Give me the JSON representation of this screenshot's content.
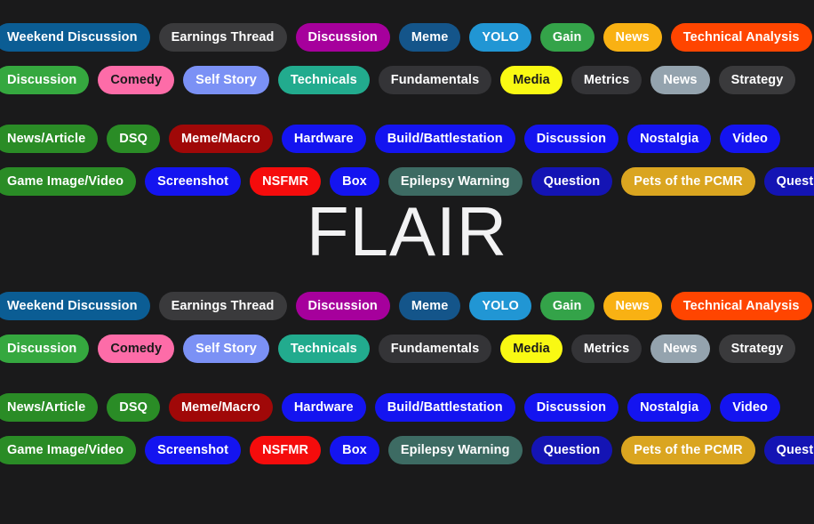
{
  "page": {
    "background_color": "#1a1a1b",
    "heading": "FLAIR",
    "heading_color": "#f2f2f3"
  },
  "flair_groups": [
    {
      "name": "group-top",
      "rows": [
        {
          "name": "row-wsb-1",
          "chips": [
            {
              "label": "Weekend Discussion",
              "bg": "#0b5d94",
              "fg": "#ffffff"
            },
            {
              "label": "Earnings Thread",
              "bg": "#3a3a3c",
              "fg": "#ffffff"
            },
            {
              "label": "Discussion",
              "bg": "#a6009c",
              "fg": "#ffffff"
            },
            {
              "label": "Meme",
              "bg": "#14558a",
              "fg": "#ffffff"
            },
            {
              "label": "YOLO",
              "bg": "#2196d4",
              "fg": "#ffffff"
            },
            {
              "label": "Gain",
              "bg": "#34a349",
              "fg": "#ffffff"
            },
            {
              "label": "News",
              "bg": "#f9b113",
              "fg": "#ffffff"
            },
            {
              "label": "Technical Analysis",
              "bg": "#ff4500",
              "fg": "#ffffff"
            }
          ]
        },
        {
          "name": "row-wsb-2",
          "chips": [
            {
              "label": "Discussion",
              "bg": "#35a83f",
              "fg": "#ffffff"
            },
            {
              "label": "Comedy",
              "bg": "#fd6ca8",
              "fg": "#1a1a1b"
            },
            {
              "label": "Self Story",
              "bg": "#7b91f5",
              "fg": "#ffffff"
            },
            {
              "label": "Technicals",
              "bg": "#22ab8e",
              "fg": "#ffffff"
            },
            {
              "label": "Fundamentals",
              "bg": "#343437",
              "fg": "#ffffff"
            },
            {
              "label": "Media",
              "bg": "#f9f913",
              "fg": "#1a1a1b"
            },
            {
              "label": "Metrics",
              "bg": "#343437",
              "fg": "#ffffff"
            },
            {
              "label": "News",
              "bg": "#94a3ae",
              "fg": "#ffffff"
            },
            {
              "label": "Strategy",
              "bg": "#3a3a3c",
              "fg": "#ffffff"
            }
          ]
        },
        {
          "name": "row-pcmr-1",
          "chips": [
            {
              "label": "News/Article",
              "bg": "#2a8c26",
              "fg": "#ffffff"
            },
            {
              "label": "DSQ",
              "bg": "#2a8c26",
              "fg": "#ffffff"
            },
            {
              "label": "Meme/Macro",
              "bg": "#a00808",
              "fg": "#ffffff"
            },
            {
              "label": "Hardware",
              "bg": "#1414f0",
              "fg": "#ffffff"
            },
            {
              "label": "Build/Battlestation",
              "bg": "#1414f0",
              "fg": "#ffffff"
            },
            {
              "label": "Discussion",
              "bg": "#1414f0",
              "fg": "#ffffff"
            },
            {
              "label": "Nostalgia",
              "bg": "#1414f0",
              "fg": "#ffffff"
            },
            {
              "label": "Video",
              "bg": "#1414f0",
              "fg": "#ffffff"
            }
          ]
        },
        {
          "name": "row-pcmr-2",
          "chips": [
            {
              "label": "Game Image/Video",
              "bg": "#2a8c26",
              "fg": "#ffffff"
            },
            {
              "label": "Screenshot",
              "bg": "#1414f0",
              "fg": "#ffffff"
            },
            {
              "label": "NSFMR",
              "bg": "#f50c0c",
              "fg": "#ffffff"
            },
            {
              "label": "Box",
              "bg": "#1414f0",
              "fg": "#ffffff"
            },
            {
              "label": "Epilepsy Warning",
              "bg": "#3d6b63",
              "fg": "#ffffff"
            },
            {
              "label": "Question",
              "bg": "#1414b4",
              "fg": "#ffffff"
            },
            {
              "label": "Pets of the PCMR",
              "bg": "#daa520",
              "fg": "#ffffff"
            },
            {
              "label": "Question",
              "bg": "#1414b4",
              "fg": "#ffffff"
            }
          ]
        }
      ]
    },
    {
      "name": "group-bottom",
      "rows": [
        {
          "name": "row-wsb-1",
          "chips": [
            {
              "label": "Weekend Discussion",
              "bg": "#0b5d94",
              "fg": "#ffffff"
            },
            {
              "label": "Earnings Thread",
              "bg": "#3a3a3c",
              "fg": "#ffffff"
            },
            {
              "label": "Discussion",
              "bg": "#a6009c",
              "fg": "#ffffff"
            },
            {
              "label": "Meme",
              "bg": "#14558a",
              "fg": "#ffffff"
            },
            {
              "label": "YOLO",
              "bg": "#2196d4",
              "fg": "#ffffff"
            },
            {
              "label": "Gain",
              "bg": "#34a349",
              "fg": "#ffffff"
            },
            {
              "label": "News",
              "bg": "#f9b113",
              "fg": "#ffffff"
            },
            {
              "label": "Technical Analysis",
              "bg": "#ff4500",
              "fg": "#ffffff"
            }
          ]
        },
        {
          "name": "row-wsb-2",
          "chips": [
            {
              "label": "Discussion",
              "bg": "#35a83f",
              "fg": "#ffffff"
            },
            {
              "label": "Comedy",
              "bg": "#fd6ca8",
              "fg": "#1a1a1b"
            },
            {
              "label": "Self Story",
              "bg": "#7b91f5",
              "fg": "#ffffff"
            },
            {
              "label": "Technicals",
              "bg": "#22ab8e",
              "fg": "#ffffff"
            },
            {
              "label": "Fundamentals",
              "bg": "#343437",
              "fg": "#ffffff"
            },
            {
              "label": "Media",
              "bg": "#f9f913",
              "fg": "#1a1a1b"
            },
            {
              "label": "Metrics",
              "bg": "#343437",
              "fg": "#ffffff"
            },
            {
              "label": "News",
              "bg": "#94a3ae",
              "fg": "#ffffff"
            },
            {
              "label": "Strategy",
              "bg": "#3a3a3c",
              "fg": "#ffffff"
            }
          ]
        },
        {
          "name": "row-pcmr-1",
          "chips": [
            {
              "label": "News/Article",
              "bg": "#2a8c26",
              "fg": "#ffffff"
            },
            {
              "label": "DSQ",
              "bg": "#2a8c26",
              "fg": "#ffffff"
            },
            {
              "label": "Meme/Macro",
              "bg": "#a00808",
              "fg": "#ffffff"
            },
            {
              "label": "Hardware",
              "bg": "#1414f0",
              "fg": "#ffffff"
            },
            {
              "label": "Build/Battlestation",
              "bg": "#1414f0",
              "fg": "#ffffff"
            },
            {
              "label": "Discussion",
              "bg": "#1414f0",
              "fg": "#ffffff"
            },
            {
              "label": "Nostalgia",
              "bg": "#1414f0",
              "fg": "#ffffff"
            },
            {
              "label": "Video",
              "bg": "#1414f0",
              "fg": "#ffffff"
            }
          ]
        },
        {
          "name": "row-pcmr-2",
          "chips": [
            {
              "label": "Game Image/Video",
              "bg": "#2a8c26",
              "fg": "#ffffff"
            },
            {
              "label": "Screenshot",
              "bg": "#1414f0",
              "fg": "#ffffff"
            },
            {
              "label": "NSFMR",
              "bg": "#f50c0c",
              "fg": "#ffffff"
            },
            {
              "label": "Box",
              "bg": "#1414f0",
              "fg": "#ffffff"
            },
            {
              "label": "Epilepsy Warning",
              "bg": "#3d6b63",
              "fg": "#ffffff"
            },
            {
              "label": "Question",
              "bg": "#1414b4",
              "fg": "#ffffff"
            },
            {
              "label": "Pets of the PCMR",
              "bg": "#daa520",
              "fg": "#ffffff"
            },
            {
              "label": "Question",
              "bg": "#1414b4",
              "fg": "#ffffff"
            }
          ]
        }
      ]
    }
  ]
}
